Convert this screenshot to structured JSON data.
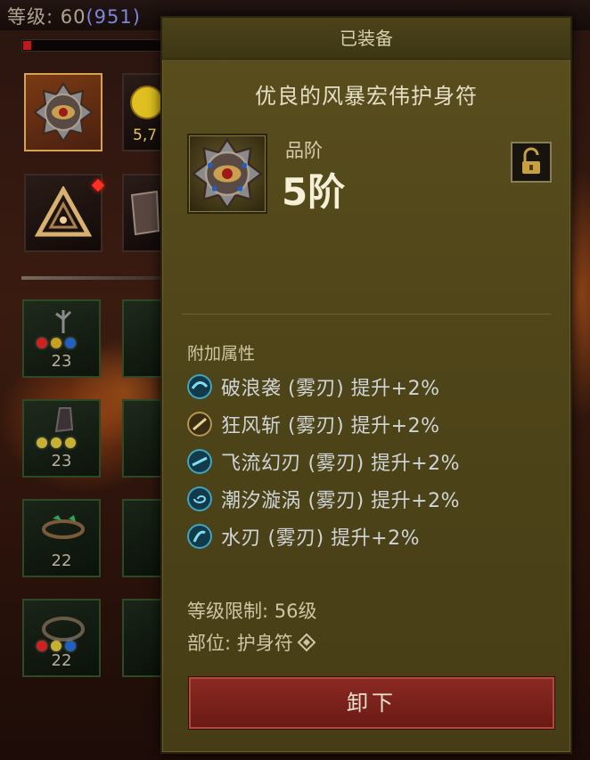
{
  "player": {
    "level_label": "等级: 60",
    "paragon": "(951)",
    "xp_progress": 0.06
  },
  "inventory": {
    "slots": [
      {
        "icon": "amulet-icon",
        "selected": true
      },
      {
        "icon": "gold-coin-icon",
        "count": "5,7"
      },
      {
        "icon": "triangle-sigil-icon",
        "notification": true
      },
      {
        "icon": "armor-icon"
      }
    ],
    "gear": [
      {
        "icon": "staff-icon",
        "num": "23",
        "gems": [
          "#d02020",
          "#c8a020",
          "#2060c0"
        ]
      },
      {
        "icon": "boots-icon",
        "num": "23",
        "gems": [
          "#c8b030",
          "#c8b030",
          "#c8b030"
        ]
      },
      {
        "icon": "ring-green-icon",
        "num": "22",
        "gems": [
          "#30a060",
          "#2060c0"
        ]
      },
      {
        "icon": "ring-icon",
        "num": "22",
        "gems": [
          "#d02020",
          "#c8b030",
          "#2060c0"
        ]
      }
    ]
  },
  "tooltip": {
    "header": "已装备",
    "item_name": "优良的风暴宏伟护身符",
    "grade_label": "品阶",
    "grade_value": "5阶",
    "lock_icon": "unlock-icon",
    "attributes_title": "附加属性",
    "attributes": [
      {
        "icon": "wave-skill-icon",
        "color": "#3fa8c8",
        "text": "破浪袭 (雾刃) 提升+2%"
      },
      {
        "icon": "wind-slash-icon",
        "color": "#b89a50",
        "text": "狂风斩 (雾刃) 提升+2%"
      },
      {
        "icon": "flowing-blade-icon",
        "color": "#3fa8c8",
        "text": "飞流幻刃 (雾刃) 提升+2%"
      },
      {
        "icon": "whirlpool-icon",
        "color": "#3fa8c8",
        "text": "潮汐漩涡 (雾刃) 提升+2%"
      },
      {
        "icon": "water-blade-icon",
        "color": "#3fa8c8",
        "text": "水刃 (雾刃) 提升+2%"
      }
    ],
    "level_req": "等级限制: 56级",
    "slot_type": "部位: 护身符",
    "slot_type_icon": "amulet-slot-icon",
    "button": "卸下"
  }
}
